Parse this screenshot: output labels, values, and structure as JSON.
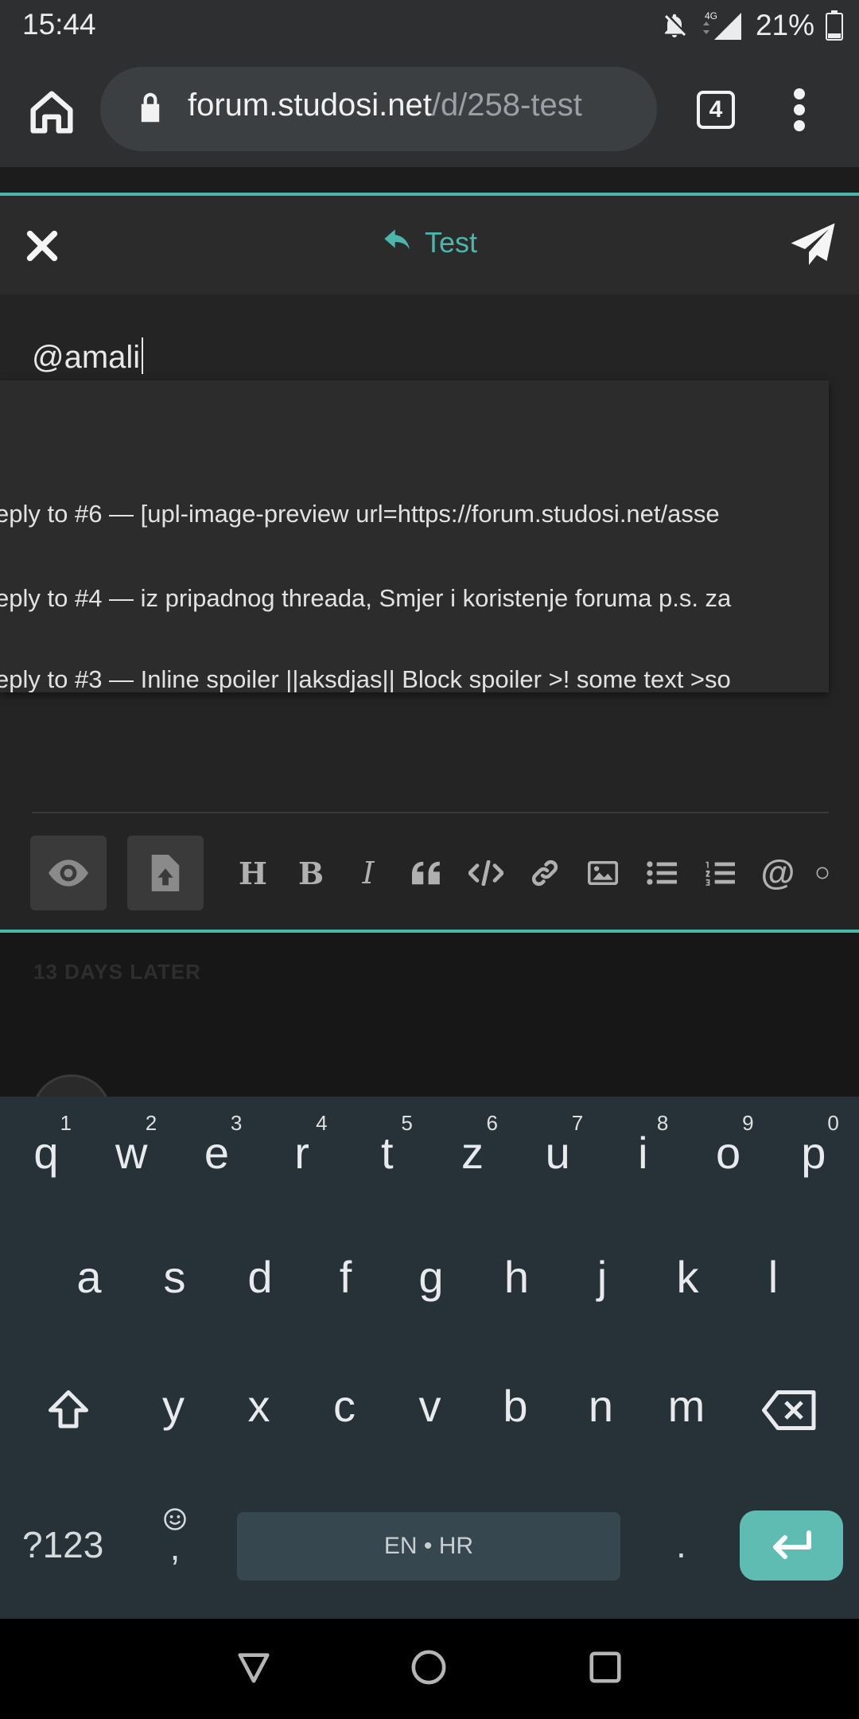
{
  "status_bar": {
    "time": "15:44",
    "battery": "21%",
    "network": "4G"
  },
  "browser": {
    "url_domain": "forum.studosi.net",
    "url_path": "/d/258-test",
    "tab_count": "4"
  },
  "composer": {
    "reply_title": "Test",
    "input_text": "@amali",
    "suggestions": [
      "eply to #6 — [upl-image-preview url=https://forum.studosi.net/asse",
      "eply to #4 — iz pripadnog threada, Smjer i koristenje foruma p.s. za",
      "eply to #3 — Inline spoiler ||aksdjas|| Block spoiler >! some text >so"
    ],
    "toolbar": {
      "heading": "H",
      "bold": "B",
      "italic": "I"
    }
  },
  "post_list": {
    "divider_label": "13 DAYS LATER"
  },
  "keyboard": {
    "row1": [
      {
        "ch": "q",
        "num": "1"
      },
      {
        "ch": "w",
        "num": "2"
      },
      {
        "ch": "e",
        "num": "3"
      },
      {
        "ch": "r",
        "num": "4"
      },
      {
        "ch": "t",
        "num": "5"
      },
      {
        "ch": "z",
        "num": "6"
      },
      {
        "ch": "u",
        "num": "7"
      },
      {
        "ch": "i",
        "num": "8"
      },
      {
        "ch": "o",
        "num": "9"
      },
      {
        "ch": "p",
        "num": "0"
      }
    ],
    "row2": [
      "a",
      "s",
      "d",
      "f",
      "g",
      "h",
      "j",
      "k",
      "l"
    ],
    "row3": [
      "y",
      "x",
      "c",
      "v",
      "b",
      "n",
      "m"
    ],
    "sym_label": "?123",
    "comma": ",",
    "space_label": "EN • HR",
    "period": "."
  },
  "colors": {
    "accent": "#4db6ac",
    "keyboard_bg": "#263238",
    "enter_key": "#5fbcb2"
  }
}
